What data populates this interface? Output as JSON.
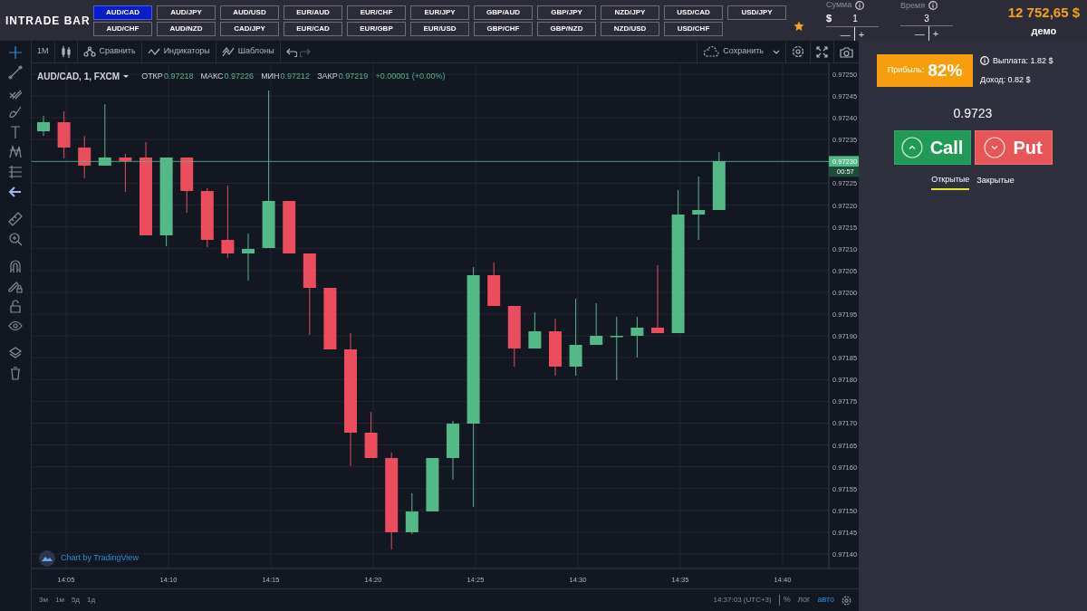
{
  "logo": {
    "text": "INTRADE BAR"
  },
  "pairs": [
    {
      "label": "AUD/CAD",
      "selected": true
    },
    {
      "label": "AUD/JPY",
      "selected": false
    },
    {
      "label": "AUD/USD",
      "selected": false
    },
    {
      "label": "EUR/AUD",
      "selected": false
    },
    {
      "label": "EUR/CHF",
      "selected": false
    },
    {
      "label": "EUR/JPY",
      "selected": false
    },
    {
      "label": "GBP/AUD",
      "selected": false
    },
    {
      "label": "GBP/JPY",
      "selected": false
    },
    {
      "label": "NZD/JPY",
      "selected": false
    },
    {
      "label": "USD/CAD",
      "selected": false
    },
    {
      "label": "USD/JPY",
      "selected": false
    },
    {
      "label": "AUD/CHF",
      "selected": false
    },
    {
      "label": "AUD/NZD",
      "selected": false
    },
    {
      "label": "CAD/JPY",
      "selected": false
    },
    {
      "label": "EUR/CAD",
      "selected": false
    },
    {
      "label": "EUR/GBP",
      "selected": false
    },
    {
      "label": "EUR/USD",
      "selected": false
    },
    {
      "label": "GBP/CHF",
      "selected": false
    },
    {
      "label": "GBP/NZD",
      "selected": false
    },
    {
      "label": "NZD/USD",
      "selected": false
    },
    {
      "label": "USD/CHF",
      "selected": false
    }
  ],
  "amount": {
    "label": "Сумма",
    "currency": "$",
    "value": "1",
    "decrement": "—",
    "increment": "+"
  },
  "duration": {
    "label": "Время",
    "value": "3",
    "decrement": "—",
    "increment": "+"
  },
  "balance": {
    "amount": "12 752,65 $",
    "mode": "демо"
  },
  "toolbar": {
    "interval": "1M",
    "compare": "Сравнить",
    "indicators": "Индикаторы",
    "templates": "Шаблоны",
    "save": "Сохранить"
  },
  "chart": {
    "symbol": "AUD/CAD, 1, FXCM",
    "ohlc": [
      {
        "label": "ОТКР",
        "value": "0.97218"
      },
      {
        "label": "МАКС",
        "value": "0.97226"
      },
      {
        "label": "МИН",
        "value": "0.97212"
      },
      {
        "label": "ЗАКР",
        "value": "0.97219"
      }
    ],
    "change": "+0.00001 (+0.00%)",
    "attribution": "Chart by TradingView",
    "price_axis": [
      {
        "kind": "tick",
        "label": "0.97250"
      },
      {
        "kind": "tick",
        "label": "0.97245"
      },
      {
        "kind": "tick",
        "label": "0.97240"
      },
      {
        "kind": "tick",
        "label": "0.97235"
      },
      {
        "kind": "current",
        "label": "0.97230",
        "countdown": "00:57"
      },
      {
        "kind": "tick",
        "label": "0.97225"
      },
      {
        "kind": "tick",
        "label": "0.97220"
      },
      {
        "kind": "tick",
        "label": "0.97215"
      },
      {
        "kind": "tick",
        "label": "0.97210"
      },
      {
        "kind": "tick",
        "label": "0.97205"
      },
      {
        "kind": "tick",
        "label": "0.97200"
      },
      {
        "kind": "tick",
        "label": "0.97195"
      },
      {
        "kind": "tick",
        "label": "0.97190"
      },
      {
        "kind": "tick",
        "label": "0.97185"
      },
      {
        "kind": "tick",
        "label": "0.97180"
      },
      {
        "kind": "tick",
        "label": "0.97175"
      },
      {
        "kind": "tick",
        "label": "0.97170"
      },
      {
        "kind": "tick",
        "label": "0.97165"
      },
      {
        "kind": "tick",
        "label": "0.97160"
      },
      {
        "kind": "tick",
        "label": "0.97155"
      },
      {
        "kind": "tick",
        "label": "0.97150"
      },
      {
        "kind": "tick",
        "label": "0.97145"
      },
      {
        "kind": "tick",
        "label": "0.97140"
      }
    ],
    "time_axis": [
      "14:05",
      "14:10",
      "14:15",
      "14:20",
      "14:25",
      "14:30",
      "14:35",
      "14:40"
    ]
  },
  "ranges": [
    "3м",
    "1м",
    "5д",
    "1д"
  ],
  "clock": "14:37:03 (UTC+3)",
  "scale_buttons": [
    {
      "label": "%",
      "selected": false
    },
    {
      "label": "лог",
      "selected": false
    },
    {
      "label": "авто",
      "selected": true
    }
  ],
  "trade": {
    "profit_label": "Прибыль:",
    "profit": "82%",
    "payout": "Выплата: 1.82 $",
    "income": "Доход: 0.82 $",
    "price": "0.9723",
    "call": "Call",
    "put": "Put"
  },
  "tabs": [
    {
      "label": "Открытые",
      "selected": true
    },
    {
      "label": "Закрытые",
      "selected": false
    }
  ]
}
